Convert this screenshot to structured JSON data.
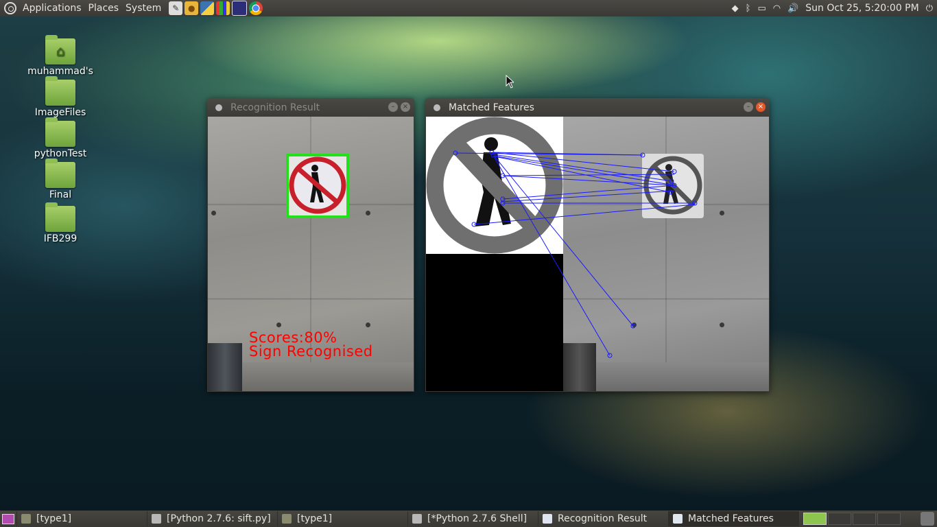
{
  "top_panel": {
    "menus": [
      "Applications",
      "Places",
      "System"
    ],
    "clock": "Sun Oct 25,  5:20:00 PM"
  },
  "desktop_icons": [
    {
      "label": "muhammad's Home",
      "icon": "home-folder-icon"
    },
    {
      "label": "ImageFiles",
      "icon": "folder-icon"
    },
    {
      "label": "pythonTest",
      "icon": "folder-icon"
    },
    {
      "label": "Final",
      "icon": "folder-icon"
    },
    {
      "label": "IFB299",
      "icon": "folder-icon"
    }
  ],
  "windows": {
    "recognition": {
      "title": "Recognition Result",
      "score_text": "Scores:80%",
      "status_text": "Sign Recognised"
    },
    "matched": {
      "title": "Matched Features"
    }
  },
  "taskbar": {
    "tasks": [
      {
        "label": "[type1]",
        "icon": "folder-icon"
      },
      {
        "label": "[Python 2.7.6: sift.py]",
        "icon": "python-editor-icon"
      },
      {
        "label": "[type1]",
        "icon": "folder-icon"
      },
      {
        "label": "[*Python 2.7.6 Shell]",
        "icon": "python-shell-icon"
      },
      {
        "label": "Recognition Result",
        "icon": "window-icon"
      },
      {
        "label": "Matched Features",
        "icon": "window-icon"
      }
    ]
  },
  "colors": {
    "panel": "#3c3b37",
    "close_active": "#e25a2b",
    "detection_box": "#22e01a",
    "overlay_text": "#ff0000",
    "match_lines": "#1a1aff"
  }
}
